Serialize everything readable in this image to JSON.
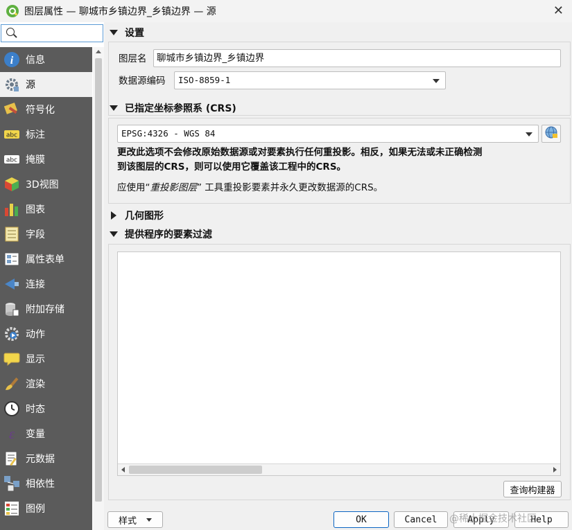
{
  "window": {
    "title": "图层属性 — 聊城市乡镇边界_乡镇边界 — 源",
    "close_glyph": "✕"
  },
  "search": {
    "placeholder": ""
  },
  "sidebar": {
    "items": [
      {
        "label": "信息",
        "icon": "info-icon"
      },
      {
        "label": "源",
        "icon": "source-icon",
        "active": true
      },
      {
        "label": "符号化",
        "icon": "symbology-icon"
      },
      {
        "label": "标注",
        "icon": "labels-icon"
      },
      {
        "label": "掩膜",
        "icon": "mask-icon"
      },
      {
        "label": "3D视图",
        "icon": "3d-view-icon"
      },
      {
        "label": "图表",
        "icon": "diagram-icon"
      },
      {
        "label": "字段",
        "icon": "fields-icon"
      },
      {
        "label": "属性表单",
        "icon": "attributes-form-icon"
      },
      {
        "label": "连接",
        "icon": "joins-icon"
      },
      {
        "label": "附加存储",
        "icon": "auxiliary-storage-icon"
      },
      {
        "label": "动作",
        "icon": "actions-icon"
      },
      {
        "label": "显示",
        "icon": "display-icon"
      },
      {
        "label": "渲染",
        "icon": "rendering-icon"
      },
      {
        "label": "时态",
        "icon": "temporal-icon"
      },
      {
        "label": "变量",
        "icon": "variables-icon"
      },
      {
        "label": "元数据",
        "icon": "metadata-icon"
      },
      {
        "label": "相依性",
        "icon": "dependencies-icon"
      },
      {
        "label": "图例",
        "icon": "legend-icon"
      }
    ]
  },
  "settings": {
    "header": "设置",
    "layer_name_label": "图层名",
    "layer_name_value": "聊城市乡镇边界_乡镇边界",
    "encoding_label": "数据源编码",
    "encoding_value": "ISO-8859-1"
  },
  "crs": {
    "header": "已指定坐标参照系 (CRS)",
    "value": "EPSG:4326 - WGS 84",
    "warning_line1": "更改此选项不会修改原始数据源或对要素执行任何重投影。相反，如果无法或未正确检测",
    "warning_line2": "到该图层的CRS，则可以使用它覆盖该工程中的CRS。",
    "hint_prefix": "应使用“",
    "hint_tool": "重投影图层",
    "hint_suffix": "” 工具重投影要素并永久更改数据源的CRS。"
  },
  "geometry": {
    "header": "几何图形"
  },
  "filter": {
    "header": "提供程序的要素过滤",
    "query_builder_label": "查询构建器"
  },
  "footer": {
    "style_label": "样式",
    "ok_label": "OK",
    "cancel_label": "Cancel",
    "apply_label": "Apply",
    "help_label": "Help",
    "watermark": "@稀土掘金技术社区"
  }
}
